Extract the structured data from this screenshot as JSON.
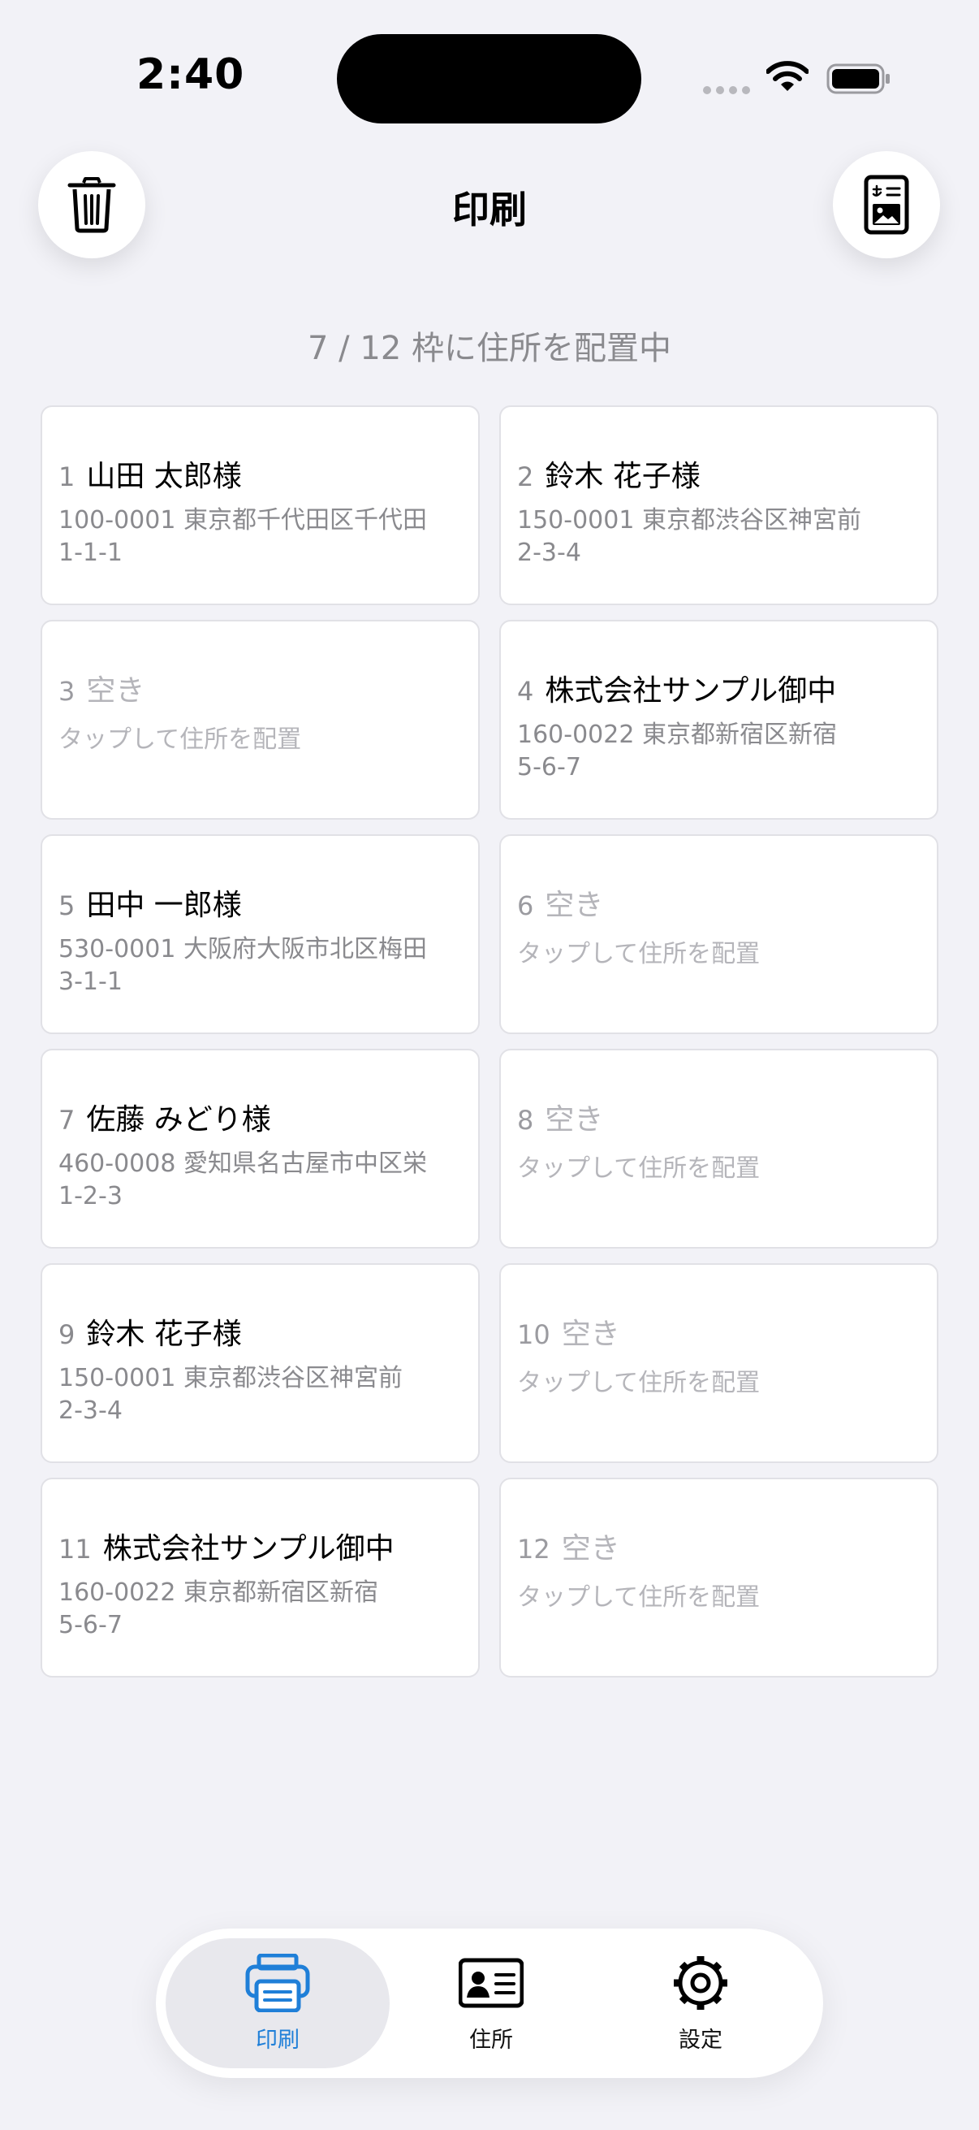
{
  "status_bar": {
    "time": "2:40"
  },
  "header": {
    "title": "印刷"
  },
  "summary": "7 / 12 枠に住所を配置中",
  "slots": [
    {
      "number": "1",
      "name": "山田 太郎様",
      "address_line1": "100-0001 東京都千代田区千代田",
      "address_line2": "1-1-1"
    },
    {
      "number": "2",
      "name": "鈴木 花子様",
      "address_line1": "150-0001 東京都渋谷区神宮前",
      "address_line2": "2-3-4"
    },
    {
      "number": "3",
      "name": "空き",
      "hint": "タップして住所を配置"
    },
    {
      "number": "4",
      "name": "株式会社サンプル御中",
      "address_line1": "160-0022 東京都新宿区新宿",
      "address_line2": "5-6-7"
    },
    {
      "number": "5",
      "name": "田中 一郎様",
      "address_line1": "530-0001 大阪府大阪市北区梅田",
      "address_line2": "3-1-1"
    },
    {
      "number": "6",
      "name": "空き",
      "hint": "タップして住所を配置"
    },
    {
      "number": "7",
      "name": "佐藤 みどり様",
      "address_line1": "460-0008 愛知県名古屋市中区栄",
      "address_line2": "1-2-3"
    },
    {
      "number": "8",
      "name": "空き",
      "hint": "タップして住所を配置"
    },
    {
      "number": "9",
      "name": "鈴木 花子様",
      "address_line1": "150-0001 東京都渋谷区神宮前",
      "address_line2": "2-3-4"
    },
    {
      "number": "10",
      "name": "空き",
      "hint": "タップして住所を配置"
    },
    {
      "number": "11",
      "name": "株式会社サンプル御中",
      "address_line1": "160-0022 東京都新宿区新宿",
      "address_line2": "5-6-7"
    },
    {
      "number": "12",
      "name": "空き",
      "hint": "タップして住所を配置"
    }
  ],
  "tabs": [
    {
      "label": "印刷",
      "icon": "printer-icon",
      "selected": true
    },
    {
      "label": "住所",
      "icon": "contact-card-icon",
      "selected": false
    },
    {
      "label": "設定",
      "icon": "gear-icon",
      "selected": false
    }
  ],
  "colors": {
    "accent": "#1f7fd8",
    "background": "#f2f2f7",
    "secondary_text": "#8a8a8e"
  }
}
